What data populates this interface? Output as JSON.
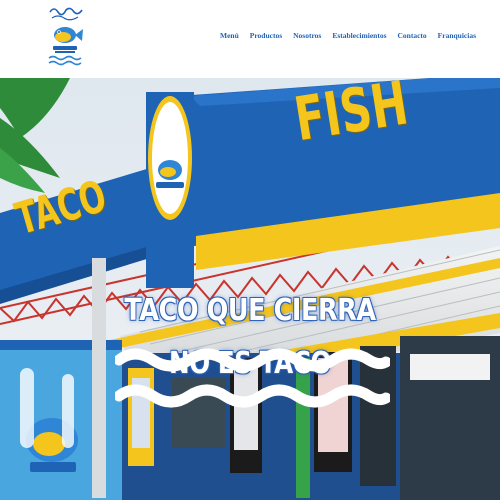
{
  "brand": {
    "logo_icon": "fish-logo-icon",
    "colors": {
      "blue": "#1f63b5",
      "yellow": "#f4c51d",
      "white": "#ffffff"
    }
  },
  "nav": {
    "items": [
      {
        "label": "Menú"
      },
      {
        "label": "Productos"
      },
      {
        "label": "Nosotros"
      },
      {
        "label": "Establecimientos"
      },
      {
        "label": "Contacto"
      },
      {
        "label": "Franquicias"
      }
    ]
  },
  "hero": {
    "headline_line1": "TACO QUE CIERRA",
    "headline_line2": "NO ES TACO",
    "sign_left": "TACO",
    "sign_right": "FISH",
    "decoration_icon": "wave-lines-icon"
  }
}
